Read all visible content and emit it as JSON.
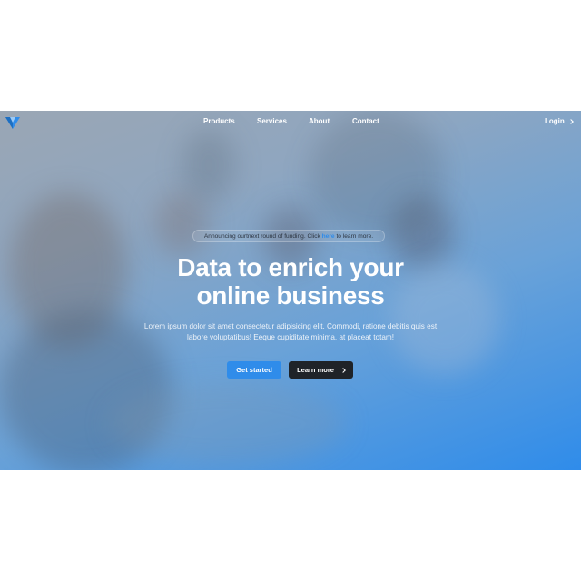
{
  "nav": {
    "logo": "logo-icon",
    "links": [
      "Products",
      "Services",
      "About",
      "Contact"
    ],
    "login_label": "Login"
  },
  "announcement": {
    "text_before": "Announcing ourtnext round of funding. Click",
    "link_text": "here",
    "text_after": "to learn more."
  },
  "hero": {
    "headline_line1": "Data to enrich your",
    "headline_line2": "online business",
    "subtext": "Lorem ipsum dolor sit amet consectetur adipisicing elit. Commodi, ratione debitis quis est labore voluptatibus! Eeque cupiditate minima, at placeat totam!"
  },
  "buttons": {
    "primary_label": "Get started",
    "secondary_label": "Learn more"
  },
  "colors": {
    "accent": "#2f8cea",
    "dark_button": "#1f2328",
    "text_white": "#ffffff"
  }
}
